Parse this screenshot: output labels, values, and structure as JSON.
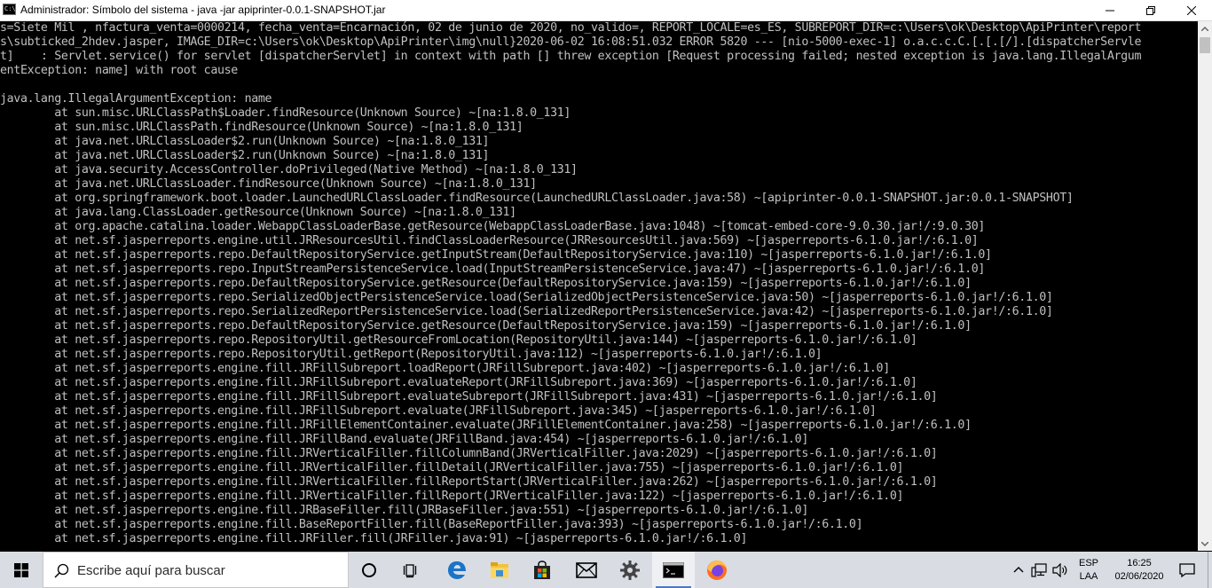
{
  "window": {
    "title": "Administrador: Símbolo del sistema - java  -jar apiprinter-0.0.1-SNAPSHOT.jar",
    "app_icon_text": "C:\\"
  },
  "console": {
    "lines": [
      "s=Siete Mil , nfactura_venta=0000214, fecha_venta=Encarnación, 02 de junio de 2020, no_valido=, REPORT_LOCALE=es_ES, SUBREPORT_DIR=c:\\Users\\ok\\Desktop\\ApiPrinter\\report",
      "s\\subticked_2hdev.jasper, IMAGE_DIR=c:\\Users\\ok\\Desktop\\ApiPrinter\\img\\null}2020-06-02 16:08:51.032 ERROR 5820 --- [nio-5000-exec-1] o.a.c.c.C.[.[.[/].[dispatcherServle",
      "t]    : Servlet.service() for servlet [dispatcherServlet] in context with path [] threw exception [Request processing failed; nested exception is java.lang.IllegalArgum",
      "entException: name] with root cause",
      "",
      "java.lang.IllegalArgumentException: name",
      "        at sun.misc.URLClassPath$Loader.findResource(Unknown Source) ~[na:1.8.0_131]",
      "        at sun.misc.URLClassPath.findResource(Unknown Source) ~[na:1.8.0_131]",
      "        at java.net.URLClassLoader$2.run(Unknown Source) ~[na:1.8.0_131]",
      "        at java.net.URLClassLoader$2.run(Unknown Source) ~[na:1.8.0_131]",
      "        at java.security.AccessController.doPrivileged(Native Method) ~[na:1.8.0_131]",
      "        at java.net.URLClassLoader.findResource(Unknown Source) ~[na:1.8.0_131]",
      "        at org.springframework.boot.loader.LaunchedURLClassLoader.findResource(LaunchedURLClassLoader.java:58) ~[apiprinter-0.0.1-SNAPSHOT.jar:0.0.1-SNAPSHOT]",
      "        at java.lang.ClassLoader.getResource(Unknown Source) ~[na:1.8.0_131]",
      "        at org.apache.catalina.loader.WebappClassLoaderBase.getResource(WebappClassLoaderBase.java:1048) ~[tomcat-embed-core-9.0.30.jar!/:9.0.30]",
      "        at net.sf.jasperreports.engine.util.JRResourcesUtil.findClassLoaderResource(JRResourcesUtil.java:569) ~[jasperreports-6.1.0.jar!/:6.1.0]",
      "        at net.sf.jasperreports.repo.DefaultRepositoryService.getInputStream(DefaultRepositoryService.java:110) ~[jasperreports-6.1.0.jar!/:6.1.0]",
      "        at net.sf.jasperreports.repo.InputStreamPersistenceService.load(InputStreamPersistenceService.java:47) ~[jasperreports-6.1.0.jar!/:6.1.0]",
      "        at net.sf.jasperreports.repo.DefaultRepositoryService.getResource(DefaultRepositoryService.java:159) ~[jasperreports-6.1.0.jar!/:6.1.0]",
      "        at net.sf.jasperreports.repo.SerializedObjectPersistenceService.load(SerializedObjectPersistenceService.java:50) ~[jasperreports-6.1.0.jar!/:6.1.0]",
      "        at net.sf.jasperreports.repo.SerializedReportPersistenceService.load(SerializedReportPersistenceService.java:42) ~[jasperreports-6.1.0.jar!/:6.1.0]",
      "        at net.sf.jasperreports.repo.DefaultRepositoryService.getResource(DefaultRepositoryService.java:159) ~[jasperreports-6.1.0.jar!/:6.1.0]",
      "        at net.sf.jasperreports.repo.RepositoryUtil.getResourceFromLocation(RepositoryUtil.java:144) ~[jasperreports-6.1.0.jar!/:6.1.0]",
      "        at net.sf.jasperreports.repo.RepositoryUtil.getReport(RepositoryUtil.java:112) ~[jasperreports-6.1.0.jar!/:6.1.0]",
      "        at net.sf.jasperreports.engine.fill.JRFillSubreport.loadReport(JRFillSubreport.java:402) ~[jasperreports-6.1.0.jar!/:6.1.0]",
      "        at net.sf.jasperreports.engine.fill.JRFillSubreport.evaluateReport(JRFillSubreport.java:369) ~[jasperreports-6.1.0.jar!/:6.1.0]",
      "        at net.sf.jasperreports.engine.fill.JRFillSubreport.evaluateSubreport(JRFillSubreport.java:431) ~[jasperreports-6.1.0.jar!/:6.1.0]",
      "        at net.sf.jasperreports.engine.fill.JRFillSubreport.evaluate(JRFillSubreport.java:345) ~[jasperreports-6.1.0.jar!/:6.1.0]",
      "        at net.sf.jasperreports.engine.fill.JRFillElementContainer.evaluate(JRFillElementContainer.java:258) ~[jasperreports-6.1.0.jar!/:6.1.0]",
      "        at net.sf.jasperreports.engine.fill.JRFillBand.evaluate(JRFillBand.java:454) ~[jasperreports-6.1.0.jar!/:6.1.0]",
      "        at net.sf.jasperreports.engine.fill.JRVerticalFiller.fillColumnBand(JRVerticalFiller.java:2029) ~[jasperreports-6.1.0.jar!/:6.1.0]",
      "        at net.sf.jasperreports.engine.fill.JRVerticalFiller.fillDetail(JRVerticalFiller.java:755) ~[jasperreports-6.1.0.jar!/:6.1.0]",
      "        at net.sf.jasperreports.engine.fill.JRVerticalFiller.fillReportStart(JRVerticalFiller.java:262) ~[jasperreports-6.1.0.jar!/:6.1.0]",
      "        at net.sf.jasperreports.engine.fill.JRVerticalFiller.fillReport(JRVerticalFiller.java:122) ~[jasperreports-6.1.0.jar!/:6.1.0]",
      "        at net.sf.jasperreports.engine.fill.JRBaseFiller.fill(JRBaseFiller.java:551) ~[jasperreports-6.1.0.jar!/:6.1.0]",
      "        at net.sf.jasperreports.engine.fill.BaseReportFiller.fill(BaseReportFiller.java:393) ~[jasperreports-6.1.0.jar!/:6.1.0]",
      "        at net.sf.jasperreports.engine.fill.JRFiller.fill(JRFiller.java:91) ~[jasperreports-6.1.0.jar!/:6.1.0]"
    ]
  },
  "taskbar": {
    "search_placeholder": "Escribe aquí para buscar",
    "pinned": [
      "start-icon",
      "cortana-icon",
      "task-view-icon",
      "edge-icon",
      "file-explorer-icon",
      "store-icon",
      "mail-icon",
      "settings-icon",
      "command-prompt-icon",
      "firefox-icon"
    ],
    "tray": {
      "lang_top": "ESP",
      "lang_bottom": "LAA",
      "time": "16:25",
      "date": "02/06/2020"
    }
  },
  "colors": {
    "console_bg": "#000000",
    "console_text": "#c0c0c0",
    "taskbar_bg": "#d9dde3",
    "accent": "#4a78c2"
  }
}
